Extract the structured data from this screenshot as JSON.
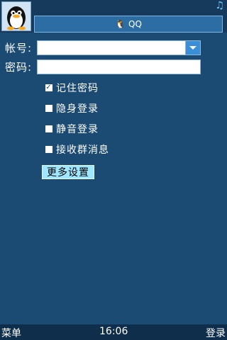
{
  "header": {
    "title": "QQ",
    "title_icon": "qq-penguin-icon",
    "status_icon": "music-note-icon",
    "avatar": "qq-penguin-avatar"
  },
  "form": {
    "account_label": "帐号:",
    "account_value": "",
    "password_label": "密码:",
    "password_value": ""
  },
  "options": [
    {
      "label": "记住密码",
      "checked": true
    },
    {
      "label": "隐身登录",
      "checked": false
    },
    {
      "label": "静音登录",
      "checked": false
    },
    {
      "label": "接收群消息",
      "checked": false
    }
  ],
  "more_settings_label": "更多设置",
  "softkeys": {
    "left": "菜单",
    "clock": "16:06",
    "right": "登录"
  },
  "colors": {
    "background": "#1b4a72",
    "accent": "#2c6ea3",
    "button": "#9fe6ff"
  }
}
